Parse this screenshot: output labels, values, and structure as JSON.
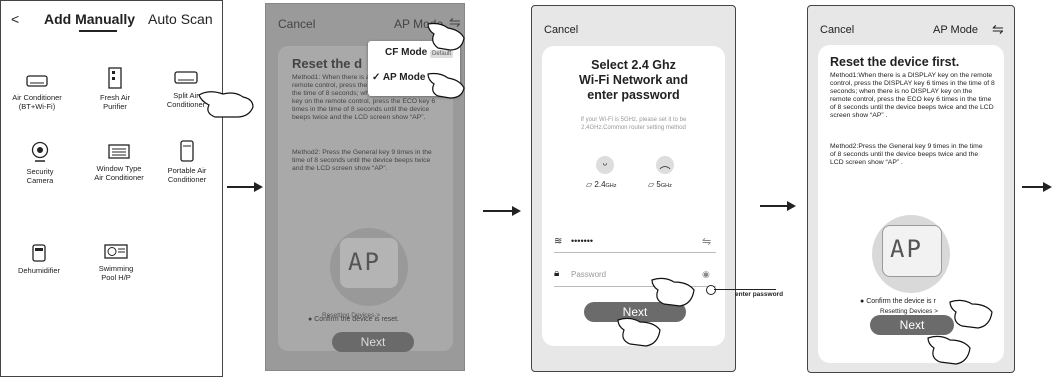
{
  "screen1": {
    "back_glyph": "<",
    "tab_manual": "Add Manually",
    "tab_scan": "Auto Scan",
    "devices": [
      {
        "name": "Air Conditioner\n(BT+Wi-Fi)",
        "icon": "ac-unit-icon"
      },
      {
        "name": "Fresh Air\nPurifier",
        "icon": "purifier-icon"
      },
      {
        "name": "Split Air\nConditioner",
        "icon": "split-ac-icon"
      },
      {
        "name": "Security\nCamera",
        "icon": "camera-icon"
      },
      {
        "name": "Window Type\nAir Conditioner",
        "icon": "window-ac-icon"
      },
      {
        "name": "Portable Air\nConditioner",
        "icon": "portable-ac-icon"
      },
      {
        "name": "Dehumidifier",
        "icon": "dehumidifier-icon"
      },
      {
        "name": "Swimming\nPool H/P",
        "icon": "pool-heat-pump-icon"
      }
    ]
  },
  "screen2": {
    "cancel": "Cancel",
    "mode_title": "AP Mode",
    "heading": "Reset the d",
    "method1": "Method1: When there is a DISPLAY key on the remote control, press the DISPLAY key 6 times in the time of 8 seconds; when there is no DISPLAY key on the remote control, press the ECO key 6 times in the time of 8 seconds until the device beeps twice and the LCD screen show “AP”.",
    "method2": "Method2: Press the General key 9 times in the time of 8 seconds until the device beeps twice and the LCD screen show “AP”.",
    "lcd": "AP",
    "resetting": "Resetting Devices >",
    "confirm": "Confirm the device is reset.",
    "next": "Next",
    "menu": {
      "cf_mode": "CF Mode",
      "cf_default": "Default",
      "ap_mode": "AP Mode"
    }
  },
  "screen3": {
    "cancel": "Cancel",
    "title": "Select 2.4 Ghz\nWi-Fi Network and\nenter password",
    "hint": "If your Wi-Fi is 5GHz, please set it to be 2.4GHz.Common router setting method",
    "band_24": "2.4",
    "band_24_unit": "GHz",
    "band_5": "5",
    "band_5_unit": "GHz",
    "ssid": "•••••••",
    "password_placeholder": "Password",
    "next": "Next",
    "callout": "enter password"
  },
  "screen4": {
    "cancel": "Cancel",
    "mode_title": "AP Mode",
    "heading": "Reset the device first.",
    "method1": "Method1:When there is a DISPLAY key on the remote control, press the DISPLAY key 6 times in the time of 8 seconds; when there is no DISPLAY key on the remote control, press the ECO key 6 times in the time of 8 seconds until the device beeps twice and the LCD screen show “AP” .",
    "method2": "Method2:Press the General key 9 times in the time of 8 seconds until the device beeps twice and the LCD screen show “AP” .",
    "lcd": "AP",
    "resetting": "Resetting Devices >",
    "confirm": "Confirm the device is r",
    "next": "Next"
  },
  "colors": {
    "button": "#6b6b6b",
    "dim_overlay": "#9a9a9a",
    "screen_bg": "#e7e7e7"
  }
}
